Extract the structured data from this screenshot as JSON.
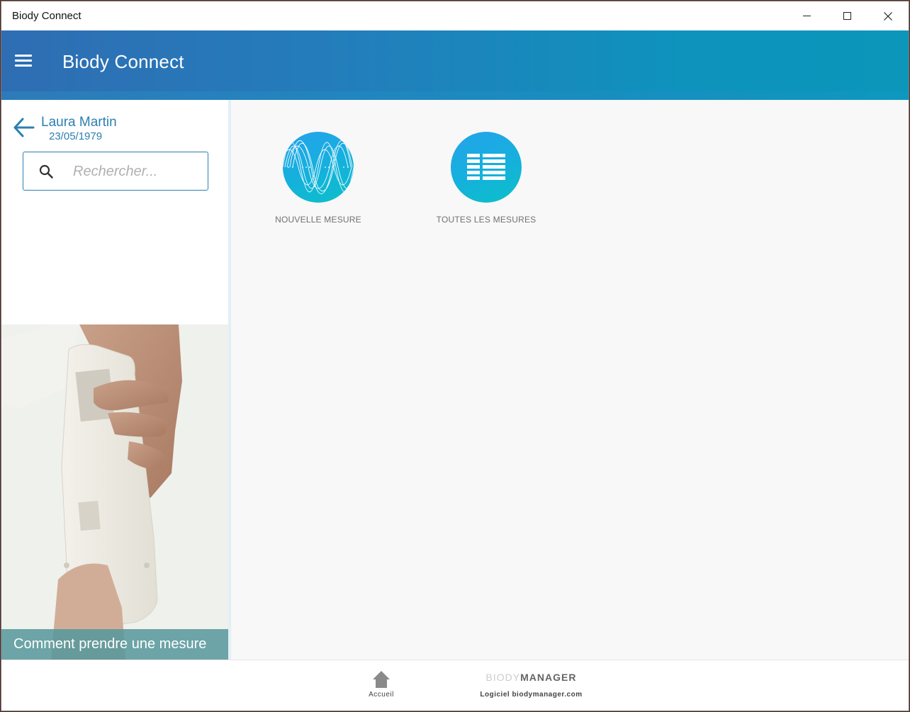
{
  "window": {
    "title": "Biody Connect"
  },
  "appbar": {
    "title": "Biody Connect"
  },
  "patient": {
    "name": "Laura Martin",
    "dob": "23/05/1979"
  },
  "search": {
    "placeholder": "Rechercher..."
  },
  "help": {
    "caption": "Comment prendre une mesure"
  },
  "tiles": [
    {
      "label": "NOUVELLE MESURE",
      "icon": "wave-icon"
    },
    {
      "label": "TOUTES LES MESURES",
      "icon": "list-icon"
    }
  ],
  "footer": {
    "home_label": "Accueil",
    "brand_light": "BIODY",
    "brand_dark": "MANAGER",
    "brand_link": "Logiciel biodymanager.com"
  },
  "colors": {
    "header_start": "#2f6db3",
    "header_end": "#0b96ba",
    "accent": "#2c7fb0",
    "tile_start": "#25a3ec",
    "tile_end": "#0cc0c8",
    "caption_bg": "#55969b"
  }
}
